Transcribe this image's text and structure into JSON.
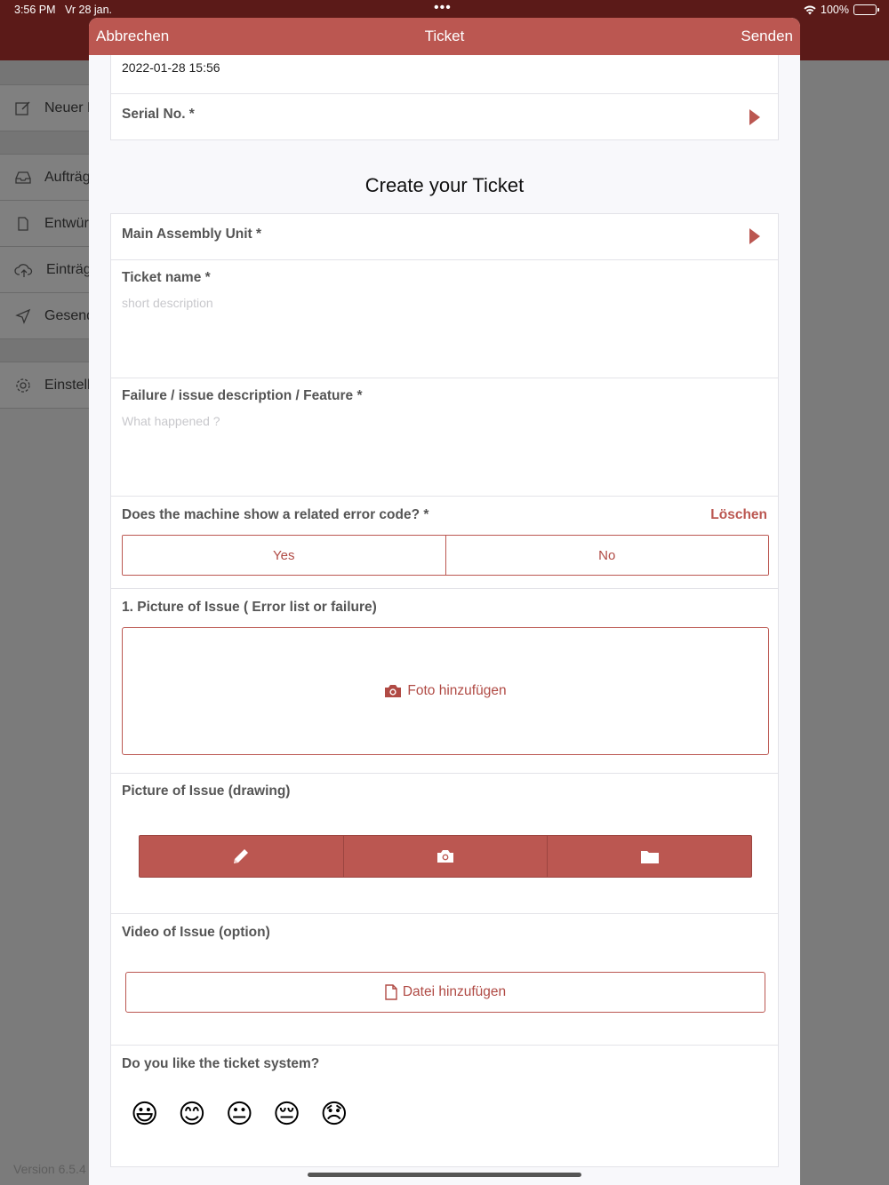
{
  "status": {
    "time": "3:56 PM",
    "date": "Vr 28 jan.",
    "battery": "100%"
  },
  "background_menu": {
    "items": [
      {
        "label": "Neuer Eintrag",
        "icon": "compose-icon"
      },
      {
        "label": "Aufträge",
        "icon": "inbox-icon"
      },
      {
        "label": "Entwürfe",
        "icon": "document-icon"
      },
      {
        "label": "Einträge",
        "icon": "cloud-upload-icon"
      },
      {
        "label": "Gesendet",
        "icon": "send-icon"
      },
      {
        "label": "Einstellungen",
        "icon": "gear-icon"
      }
    ],
    "version": "Version 6.5.4"
  },
  "nav": {
    "cancel": "Abbrechen",
    "title": "Ticket",
    "send": "Senden"
  },
  "top_card": {
    "date": "2022-01-28 15:56",
    "serial_label": "Serial No. *"
  },
  "section_title": "Create your Ticket",
  "form": {
    "main_assembly": "Main Assembly Unit *",
    "ticket_name": {
      "label": "Ticket name *",
      "placeholder": "short description"
    },
    "failure": {
      "label": "Failure / issue description / Feature *",
      "placeholder": "What happened ?"
    },
    "error_code": {
      "label": "Does the machine show a related error code? *",
      "clear": "Löschen",
      "yes": "Yes",
      "no": "No"
    },
    "picture1": {
      "label": "1. Picture of Issue ( Error list or failure)",
      "button": "Foto hinzufügen"
    },
    "picture_drawing": {
      "label": "Picture of Issue (drawing)",
      "tools": [
        "pencil-icon",
        "camera-icon",
        "folder-icon"
      ]
    },
    "video": {
      "label": "Video of Issue (option)",
      "button": "Datei hinzufügen"
    },
    "rating": {
      "label": "Do you like the ticket system?",
      "emojis": [
        "😃",
        "😊",
        "😐",
        "😔",
        "😞"
      ]
    }
  },
  "colors": {
    "accent": "#bb5751",
    "status_bar": "#5b1a18"
  }
}
